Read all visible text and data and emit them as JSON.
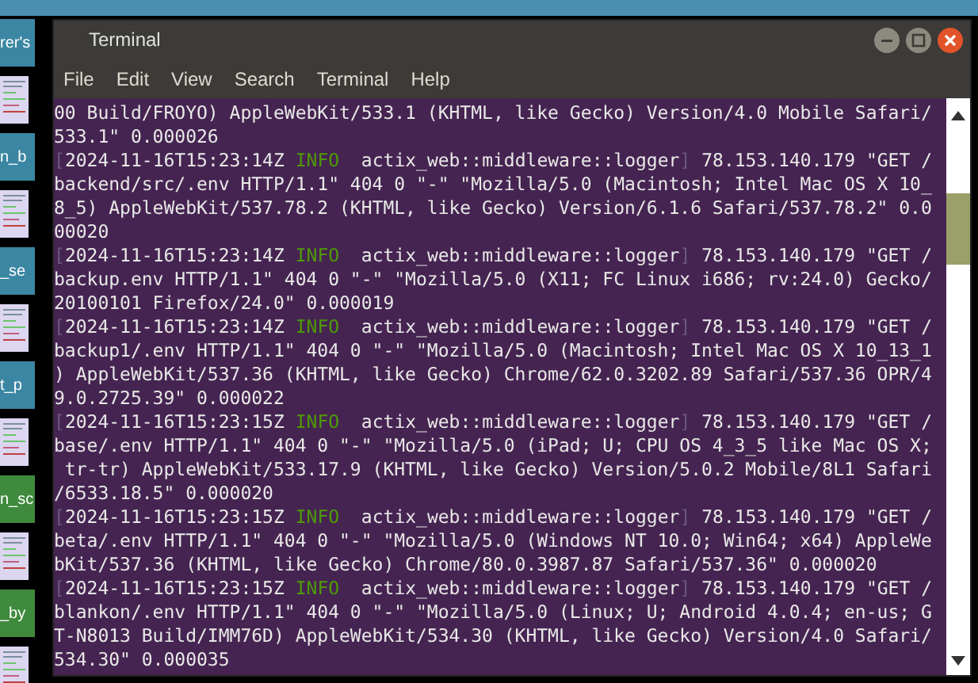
{
  "desktop_icons": [
    {
      "label": "rer's",
      "color": "#3b86a3"
    },
    {
      "label": "n_b",
      "color": "#3b86a3"
    },
    {
      "label": "_se",
      "color": "#3b86a3"
    },
    {
      "label": "t_p",
      "color": "#3b86a3"
    },
    {
      "label": "n_sc",
      "color": "#3f8a3c"
    },
    {
      "label": "_by",
      "color": "#3f8a3c"
    }
  ],
  "window": {
    "title": "Terminal"
  },
  "menu": [
    "File",
    "Edit",
    "View",
    "Search",
    "Terminal",
    "Help"
  ],
  "lines": [
    {
      "kind": "text",
      "text": "00 Build/FROYO) AppleWebKit/533.1 (KHTML, like Gecko) Version/4.0 Mobile Safari/"
    },
    {
      "kind": "text",
      "text": "533.1\" 0.000026"
    },
    {
      "kind": "log",
      "open": "[",
      "timestamp": "2024-11-16T15:23:14Z",
      "level": "INFO",
      "target": "actix_web::middleware::logger",
      "close": "]",
      "rest": "78.153.140.179 \"GET /"
    },
    {
      "kind": "text",
      "text": "backend/src/.env HTTP/1.1\" 404 0 \"-\" \"Mozilla/5.0 (Macintosh; Intel Mac OS X 10_"
    },
    {
      "kind": "text",
      "text": "8_5) AppleWebKit/537.78.2 (KHTML, like Gecko) Version/6.1.6 Safari/537.78.2\" 0.0"
    },
    {
      "kind": "text",
      "text": "00020"
    },
    {
      "kind": "log",
      "open": "[",
      "timestamp": "2024-11-16T15:23:14Z",
      "level": "INFO",
      "target": "actix_web::middleware::logger",
      "close": "]",
      "rest": "78.153.140.179 \"GET /"
    },
    {
      "kind": "text",
      "text": "backup.env HTTP/1.1\" 404 0 \"-\" \"Mozilla/5.0 (X11; FC Linux i686; rv:24.0) Gecko/"
    },
    {
      "kind": "text",
      "text": "20100101 Firefox/24.0\" 0.000019"
    },
    {
      "kind": "log",
      "open": "[",
      "timestamp": "2024-11-16T15:23:14Z",
      "level": "INFO",
      "target": "actix_web::middleware::logger",
      "close": "]",
      "rest": "78.153.140.179 \"GET /"
    },
    {
      "kind": "text",
      "text": "backup1/.env HTTP/1.1\" 404 0 \"-\" \"Mozilla/5.0 (Macintosh; Intel Mac OS X 10_13_1"
    },
    {
      "kind": "text",
      "text": ") AppleWebKit/537.36 (KHTML, like Gecko) Chrome/62.0.3202.89 Safari/537.36 OPR/4"
    },
    {
      "kind": "text",
      "text": "9.0.2725.39\" 0.000022"
    },
    {
      "kind": "log",
      "open": "[",
      "timestamp": "2024-11-16T15:23:15Z",
      "level": "INFO",
      "target": "actix_web::middleware::logger",
      "close": "]",
      "rest": "78.153.140.179 \"GET /"
    },
    {
      "kind": "text",
      "text": "base/.env HTTP/1.1\" 404 0 \"-\" \"Mozilla/5.0 (iPad; U; CPU OS 4_3_5 like Mac OS X;"
    },
    {
      "kind": "text",
      "text": " tr-tr) AppleWebKit/533.17.9 (KHTML, like Gecko) Version/5.0.2 Mobile/8L1 Safari"
    },
    {
      "kind": "text",
      "text": "/6533.18.5\" 0.000020"
    },
    {
      "kind": "log",
      "open": "[",
      "timestamp": "2024-11-16T15:23:15Z",
      "level": "INFO",
      "target": "actix_web::middleware::logger",
      "close": "]",
      "rest": "78.153.140.179 \"GET /"
    },
    {
      "kind": "text",
      "text": "beta/.env HTTP/1.1\" 404 0 \"-\" \"Mozilla/5.0 (Windows NT 10.0; Win64; x64) AppleWe"
    },
    {
      "kind": "text",
      "text": "bKit/537.36 (KHTML, like Gecko) Chrome/80.0.3987.87 Safari/537.36\" 0.000020"
    },
    {
      "kind": "log",
      "open": "[",
      "timestamp": "2024-11-16T15:23:15Z",
      "level": "INFO",
      "target": "actix_web::middleware::logger",
      "close": "]",
      "rest": "78.153.140.179 \"GET /"
    },
    {
      "kind": "text",
      "text": "blankon/.env HTTP/1.1\" 404 0 \"-\" \"Mozilla/5.0 (Linux; U; Android 4.0.4; en-us; G"
    },
    {
      "kind": "text",
      "text": "T-N8013 Build/IMM76D) AppleWebKit/534.30 (KHTML, like Gecko) Version/4.0 Safari/"
    },
    {
      "kind": "text",
      "text": "534.30\" 0.000035"
    }
  ]
}
